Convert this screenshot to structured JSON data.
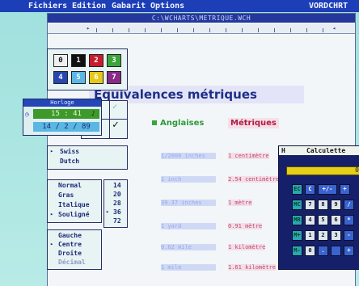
{
  "menubar": {
    "items": [
      "Fichiers",
      "Edition",
      "Gabarit",
      "Options"
    ],
    "app_name": "VORDCHRT"
  },
  "document": {
    "path": "C:\\WCHARTS\\METRIQUE.WCH",
    "title": "Equivalences métriques",
    "col_left_label": "Anglaises",
    "col_right_label": "Métriques",
    "rows": [
      {
        "left": "1/2000 inches",
        "right": "1 centimètre"
      },
      {
        "left": "1 inch",
        "right": "2.54 centimètres"
      },
      {
        "left": "39.37 inches",
        "right": "1 mètre"
      },
      {
        "left": "1 yard",
        "right": "0.91 mètre"
      },
      {
        "left": "0.62 mile",
        "right": "1 kilomètre"
      },
      {
        "left": "1 mile",
        "right": "1.61 kilomètre"
      }
    ]
  },
  "colors_panel": {
    "labels": [
      "0",
      "1",
      "2",
      "3",
      "4",
      "5",
      "6",
      "7"
    ],
    "colors": [
      "#f0f0f0",
      "#101010",
      "#c81c2e",
      "#3aa63a",
      "#2646b4",
      "#5bb8e6",
      "#e6c81a",
      "#8a2a8a"
    ]
  },
  "clock": {
    "title": "Horloge",
    "time": "15 : 41",
    "date": "14 / 2 / 89"
  },
  "fonts_panel": {
    "items": [
      "Swiss",
      "Dutch"
    ]
  },
  "styles_panel": {
    "items": [
      "Normal",
      "Gras",
      "Italique",
      "Souligné"
    ]
  },
  "sizes_panel": {
    "items": [
      "14",
      "20",
      "28",
      "36",
      "72"
    ]
  },
  "align_panel": {
    "items": [
      "Gauche",
      "Centre",
      "Droite",
      "Décimal"
    ]
  },
  "calculator": {
    "title": "Calculette",
    "display": "0",
    "rows": [
      [
        "EC",
        "C",
        "+/-",
        "÷"
      ],
      [
        "MC",
        "7",
        "8",
        "9",
        "/"
      ],
      [
        "MR",
        "4",
        "5",
        "6",
        "*"
      ],
      [
        "M+",
        "1",
        "2",
        "3",
        "-"
      ],
      [
        "M-",
        "0",
        ".",
        "",
        "+"
      ]
    ]
  }
}
